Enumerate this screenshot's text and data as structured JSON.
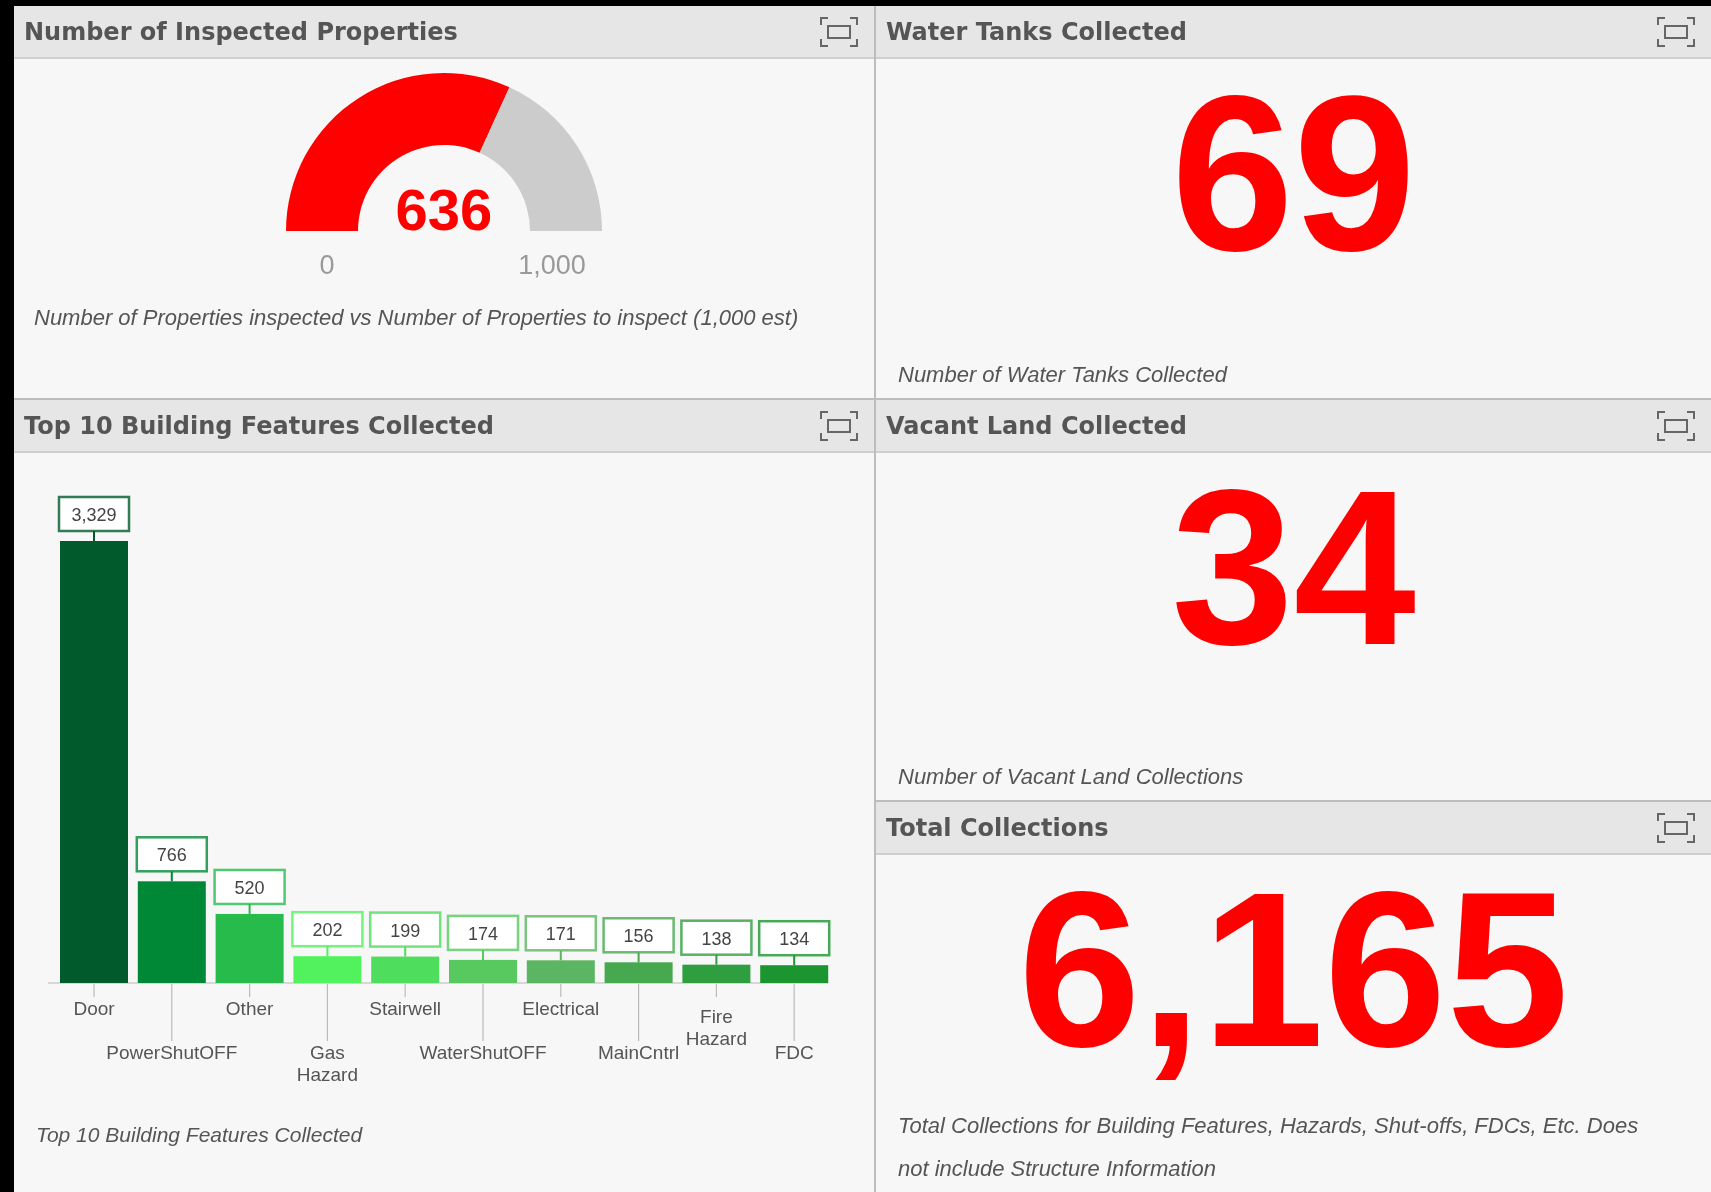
{
  "panels": [
    {
      "kind": "gauge",
      "title": "Number of Inspected Properties",
      "gauge": {
        "value": "636",
        "min": "0",
        "max": "1,000"
      },
      "caption": "Number of Properties inspected vs Number of Properties to inspect (1,000 est)"
    },
    {
      "kind": "number",
      "title": "Water Tanks Collected",
      "value": "69",
      "caption": "Number of Water Tanks Collected"
    },
    {
      "kind": "chart",
      "title": "Top 10 Building Features Collected",
      "chart_data": {
        "type": "bar",
        "categories": [
          "Door",
          "PowerShutOFF",
          "Other",
          "Gas Hazard",
          "Stairwell",
          "WaterShutOFF",
          "Electrical",
          "MainCntrl",
          "Fire Hazard",
          "FDC"
        ],
        "values": [
          3329,
          766,
          520,
          202,
          199,
          174,
          171,
          156,
          138,
          134
        ],
        "colors": [
          "#005a2b",
          "#008837",
          "#27bb4c",
          "#52f25e",
          "#4fdd5d",
          "#58c95f",
          "#5cb562",
          "#46a84f",
          "#2e9e3f",
          "#1a9530"
        ],
        "value_labels": [
          "3,329",
          "766",
          "520",
          "202",
          "199",
          "174",
          "171",
          "156",
          "138",
          "134"
        ]
      },
      "caption": "Top 10 Building Features Collected"
    },
    {
      "kind": "number",
      "title": "Vacant Land Collected",
      "value": "34",
      "caption": "Number of Vacant Land Collections"
    },
    {
      "kind": "number",
      "title": "Total Collections",
      "value": "6,165",
      "caption": "Total Collections for Building Features, Hazards, Shut-offs, FDCs, Etc. Does not include Structure Information"
    }
  ]
}
